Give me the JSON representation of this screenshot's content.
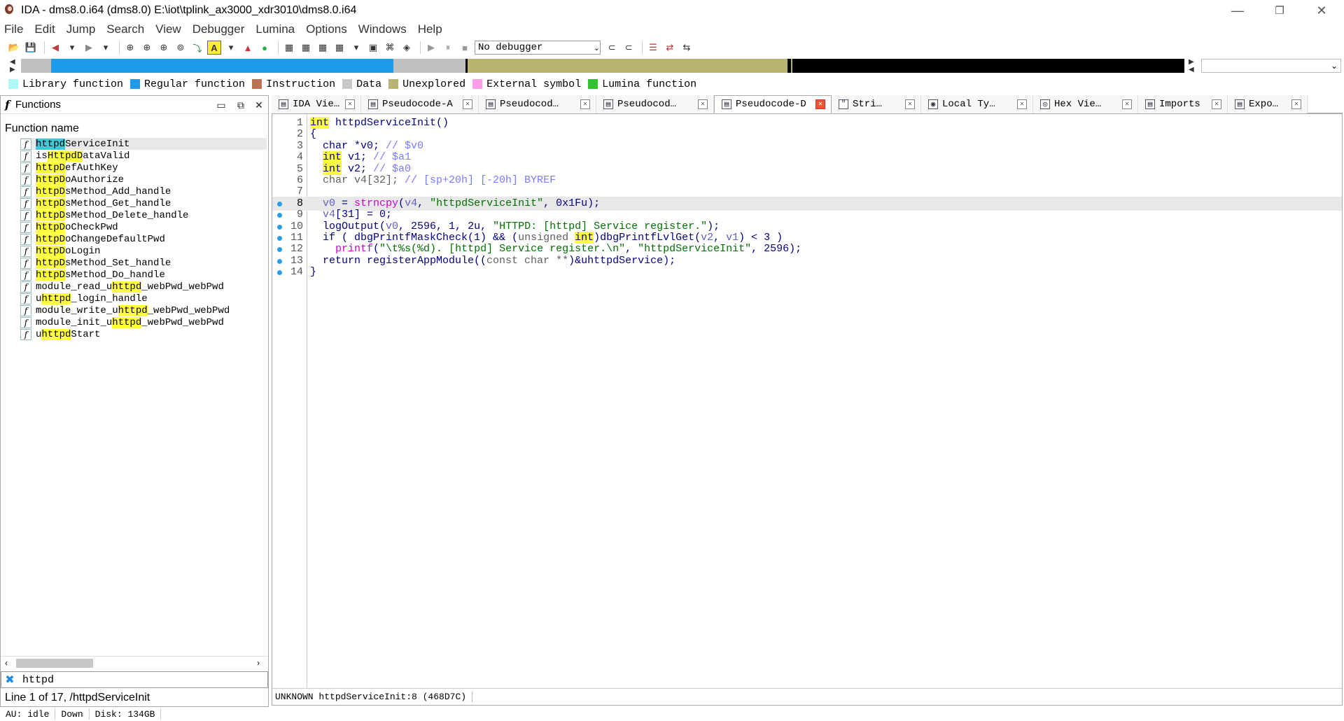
{
  "window": {
    "title": "IDA - dms8.0.i64 (dms8.0) E:\\iot\\tplink_ax3000_xdr3010\\dms8.0.i64",
    "minimize": "—",
    "maximize": "❐",
    "close": "✕"
  },
  "menu": [
    "File",
    "Edit",
    "Jump",
    "Search",
    "View",
    "Debugger",
    "Lumina",
    "Options",
    "Windows",
    "Help"
  ],
  "toolbar": {
    "debugger_select": "No debugger"
  },
  "nav_band": {
    "segments": [
      {
        "color": "#c0c0c0",
        "fraction": 0.026
      },
      {
        "color": "#1e9be8",
        "fraction": 0.294
      },
      {
        "color": "#c0c0c0",
        "fraction": 0.062
      },
      {
        "color": "#000000",
        "fraction": 0.002
      },
      {
        "color": "#b8b370",
        "fraction": 0.275
      },
      {
        "color": "#000000",
        "fraction": 0.003
      },
      {
        "color": "#b8b370",
        "fraction": 0.001
      },
      {
        "color": "#000000",
        "fraction": 0.337
      }
    ]
  },
  "legend": [
    {
      "label": "Library function",
      "color": "#b0f8f8"
    },
    {
      "label": "Regular function",
      "color": "#1e9be8"
    },
    {
      "label": "Instruction",
      "color": "#b87353"
    },
    {
      "label": "Data",
      "color": "#c8c8c8"
    },
    {
      "label": "Unexplored",
      "color": "#b8b370"
    },
    {
      "label": "External symbol",
      "color": "#ff9ee8"
    },
    {
      "label": "Lumina function",
      "color": "#30c030"
    }
  ],
  "functions_panel": {
    "title": "Functions",
    "column_header": "Function name",
    "icon_glyph": "f",
    "items": [
      {
        "pre": "",
        "hl": "httpd",
        "post": "ServiceInit",
        "selected": true
      },
      {
        "pre": "is",
        "hl": "Httpd",
        "post": "ataValid",
        "mid": "D",
        "selected": false
      },
      {
        "pre": "",
        "hl": "httpD",
        "post": "efAuthKey",
        "selected": false
      },
      {
        "pre": "",
        "hl": "httpD",
        "post": "oAuthorize",
        "selected": false
      },
      {
        "pre": "",
        "hl": "httpD",
        "post": "sMethod_Add_handle",
        "selected": false
      },
      {
        "pre": "",
        "hl": "httpD",
        "post": "sMethod_Get_handle",
        "selected": false
      },
      {
        "pre": "",
        "hl": "httpD",
        "post": "sMethod_Delete_handle",
        "selected": false
      },
      {
        "pre": "",
        "hl": "httpD",
        "post": "oCheckPwd",
        "selected": false
      },
      {
        "pre": "",
        "hl": "httpD",
        "post": "oChangeDefaultPwd",
        "selected": false
      },
      {
        "pre": "",
        "hl": "httpD",
        "post": "oLogin",
        "selected": false
      },
      {
        "pre": "",
        "hl": "httpD",
        "post": "sMethod_Set_handle",
        "selected": false
      },
      {
        "pre": "",
        "hl": "httpD",
        "post": "sMethod_Do_handle",
        "selected": false
      },
      {
        "pre": "module_read_u",
        "hl": "httpd",
        "post": "_webPwd_webPwd",
        "selected": false
      },
      {
        "pre": "u",
        "hl": "httpd",
        "post": "_login_handle",
        "selected": false
      },
      {
        "pre": "module_write_u",
        "hl": "httpd",
        "post": "_webPwd_webPwd",
        "selected": false
      },
      {
        "pre": "module_init_u",
        "hl": "httpd",
        "post": "_webPwd_webPwd",
        "selected": false
      },
      {
        "pre": "u",
        "hl": "httpd",
        "post": "Start",
        "selected": false
      }
    ],
    "filter_value": "httpd",
    "line_status": "Line 1 of 17, /httpdServiceInit"
  },
  "tabs": [
    {
      "label": "IDA Vie…",
      "icon": "▤",
      "width": 128,
      "active": false
    },
    {
      "label": "Pseudocode-A",
      "icon": "▤",
      "width": 168,
      "active": false
    },
    {
      "label": "Pseudocod…",
      "icon": "▤",
      "width": 168,
      "active": false
    },
    {
      "label": "Pseudocod…",
      "icon": "▤",
      "width": 168,
      "active": false
    },
    {
      "label": "Pseudocode-D",
      "icon": "▤",
      "width": 168,
      "active": true
    },
    {
      "label": "Stri…",
      "icon": "\"",
      "width": 128,
      "active": false
    },
    {
      "label": "Local Ty…",
      "icon": "◉",
      "width": 160,
      "active": false
    },
    {
      "label": "Hex Vie…",
      "icon": "◎",
      "width": 150,
      "active": false
    },
    {
      "label": "Imports",
      "icon": "▤",
      "width": 128,
      "active": false
    },
    {
      "label": "Expo…",
      "icon": "▤",
      "width": 114,
      "active": false
    }
  ],
  "code": {
    "lines": [
      {
        "n": "1",
        "dot": false,
        "current": false,
        "tokens": [
          [
            "hl-kw",
            "int"
          ],
          [
            "plain",
            " httpdServiceInit()"
          ]
        ]
      },
      {
        "n": "2",
        "dot": false,
        "current": false,
        "tokens": [
          [
            "plain",
            "{"
          ]
        ]
      },
      {
        "n": "3",
        "dot": false,
        "current": false,
        "tokens": [
          [
            "plain",
            "  char *v0; "
          ],
          [
            "cmt",
            "// $v0"
          ]
        ]
      },
      {
        "n": "4",
        "dot": false,
        "current": false,
        "tokens": [
          [
            "plain",
            "  "
          ],
          [
            "hl-kw",
            "int"
          ],
          [
            "plain",
            " v1; "
          ],
          [
            "cmt",
            "// $a1"
          ]
        ]
      },
      {
        "n": "5",
        "dot": false,
        "current": false,
        "tokens": [
          [
            "plain",
            "  "
          ],
          [
            "hl-kw",
            "int"
          ],
          [
            "plain",
            " v2; "
          ],
          [
            "cmt",
            "// $a0"
          ]
        ]
      },
      {
        "n": "6",
        "dot": false,
        "current": false,
        "tokens": [
          [
            "gray",
            "  char v4[32]; "
          ],
          [
            "cmt",
            "// [sp+20h] [-20h] BYREF"
          ]
        ]
      },
      {
        "n": "7",
        "dot": false,
        "current": false,
        "tokens": [
          [
            "plain",
            ""
          ]
        ]
      },
      {
        "n": "8",
        "dot": true,
        "current": true,
        "tokens": [
          [
            "var",
            "  v0"
          ],
          [
            "plain",
            " = "
          ],
          [
            "imp",
            "strncpy"
          ],
          [
            "plain",
            "("
          ],
          [
            "var",
            "v4"
          ],
          [
            "plain",
            ", "
          ],
          [
            "str",
            "\"httpdServiceInit\""
          ],
          [
            "plain",
            ", "
          ],
          [
            "plain",
            "0x1Fu);"
          ]
        ]
      },
      {
        "n": "9",
        "dot": true,
        "current": false,
        "tokens": [
          [
            "var",
            "  v4"
          ],
          [
            "plain",
            "[31] = 0;"
          ]
        ]
      },
      {
        "n": "10",
        "dot": true,
        "current": false,
        "tokens": [
          [
            "plain",
            "  logOutput("
          ],
          [
            "var",
            "v0"
          ],
          [
            "plain",
            ", 2596, 1, 2u, "
          ],
          [
            "str",
            "\"HTTPD: [httpd] Service register.\""
          ],
          [
            "plain",
            ");"
          ]
        ]
      },
      {
        "n": "11",
        "dot": true,
        "current": false,
        "tokens": [
          [
            "plain",
            "  if ( dbgPrintfMaskCheck(1) && ("
          ],
          [
            "gray",
            "unsigned "
          ],
          [
            "hl-kw",
            "int"
          ],
          [
            "plain",
            ")dbgPrintfLvlGet("
          ],
          [
            "var",
            "v2"
          ],
          [
            "plain",
            ", "
          ],
          [
            "var",
            "v1"
          ],
          [
            "plain",
            ") < 3 )"
          ]
        ]
      },
      {
        "n": "12",
        "dot": true,
        "current": false,
        "tokens": [
          [
            "plain",
            "    "
          ],
          [
            "imp",
            "printf"
          ],
          [
            "plain",
            "("
          ],
          [
            "str",
            "\"\\t%s(%d). [httpd] Service register.\\n\""
          ],
          [
            "plain",
            ", "
          ],
          [
            "str",
            "\"httpdServiceInit\""
          ],
          [
            "plain",
            ", 2596);"
          ]
        ]
      },
      {
        "n": "13",
        "dot": true,
        "current": false,
        "tokens": [
          [
            "plain",
            "  return registerAppModule(("
          ],
          [
            "gray",
            "const char **"
          ],
          [
            "plain",
            ")&uhttpdService);"
          ]
        ]
      },
      {
        "n": "14",
        "dot": true,
        "current": false,
        "tokens": [
          [
            "plain",
            "}"
          ]
        ]
      }
    ],
    "status": "UNKNOWN httpdServiceInit:8 (468D7C)"
  },
  "statusbar": {
    "au": "AU:  idle",
    "down": "Down",
    "disk": "Disk: 134GB"
  }
}
